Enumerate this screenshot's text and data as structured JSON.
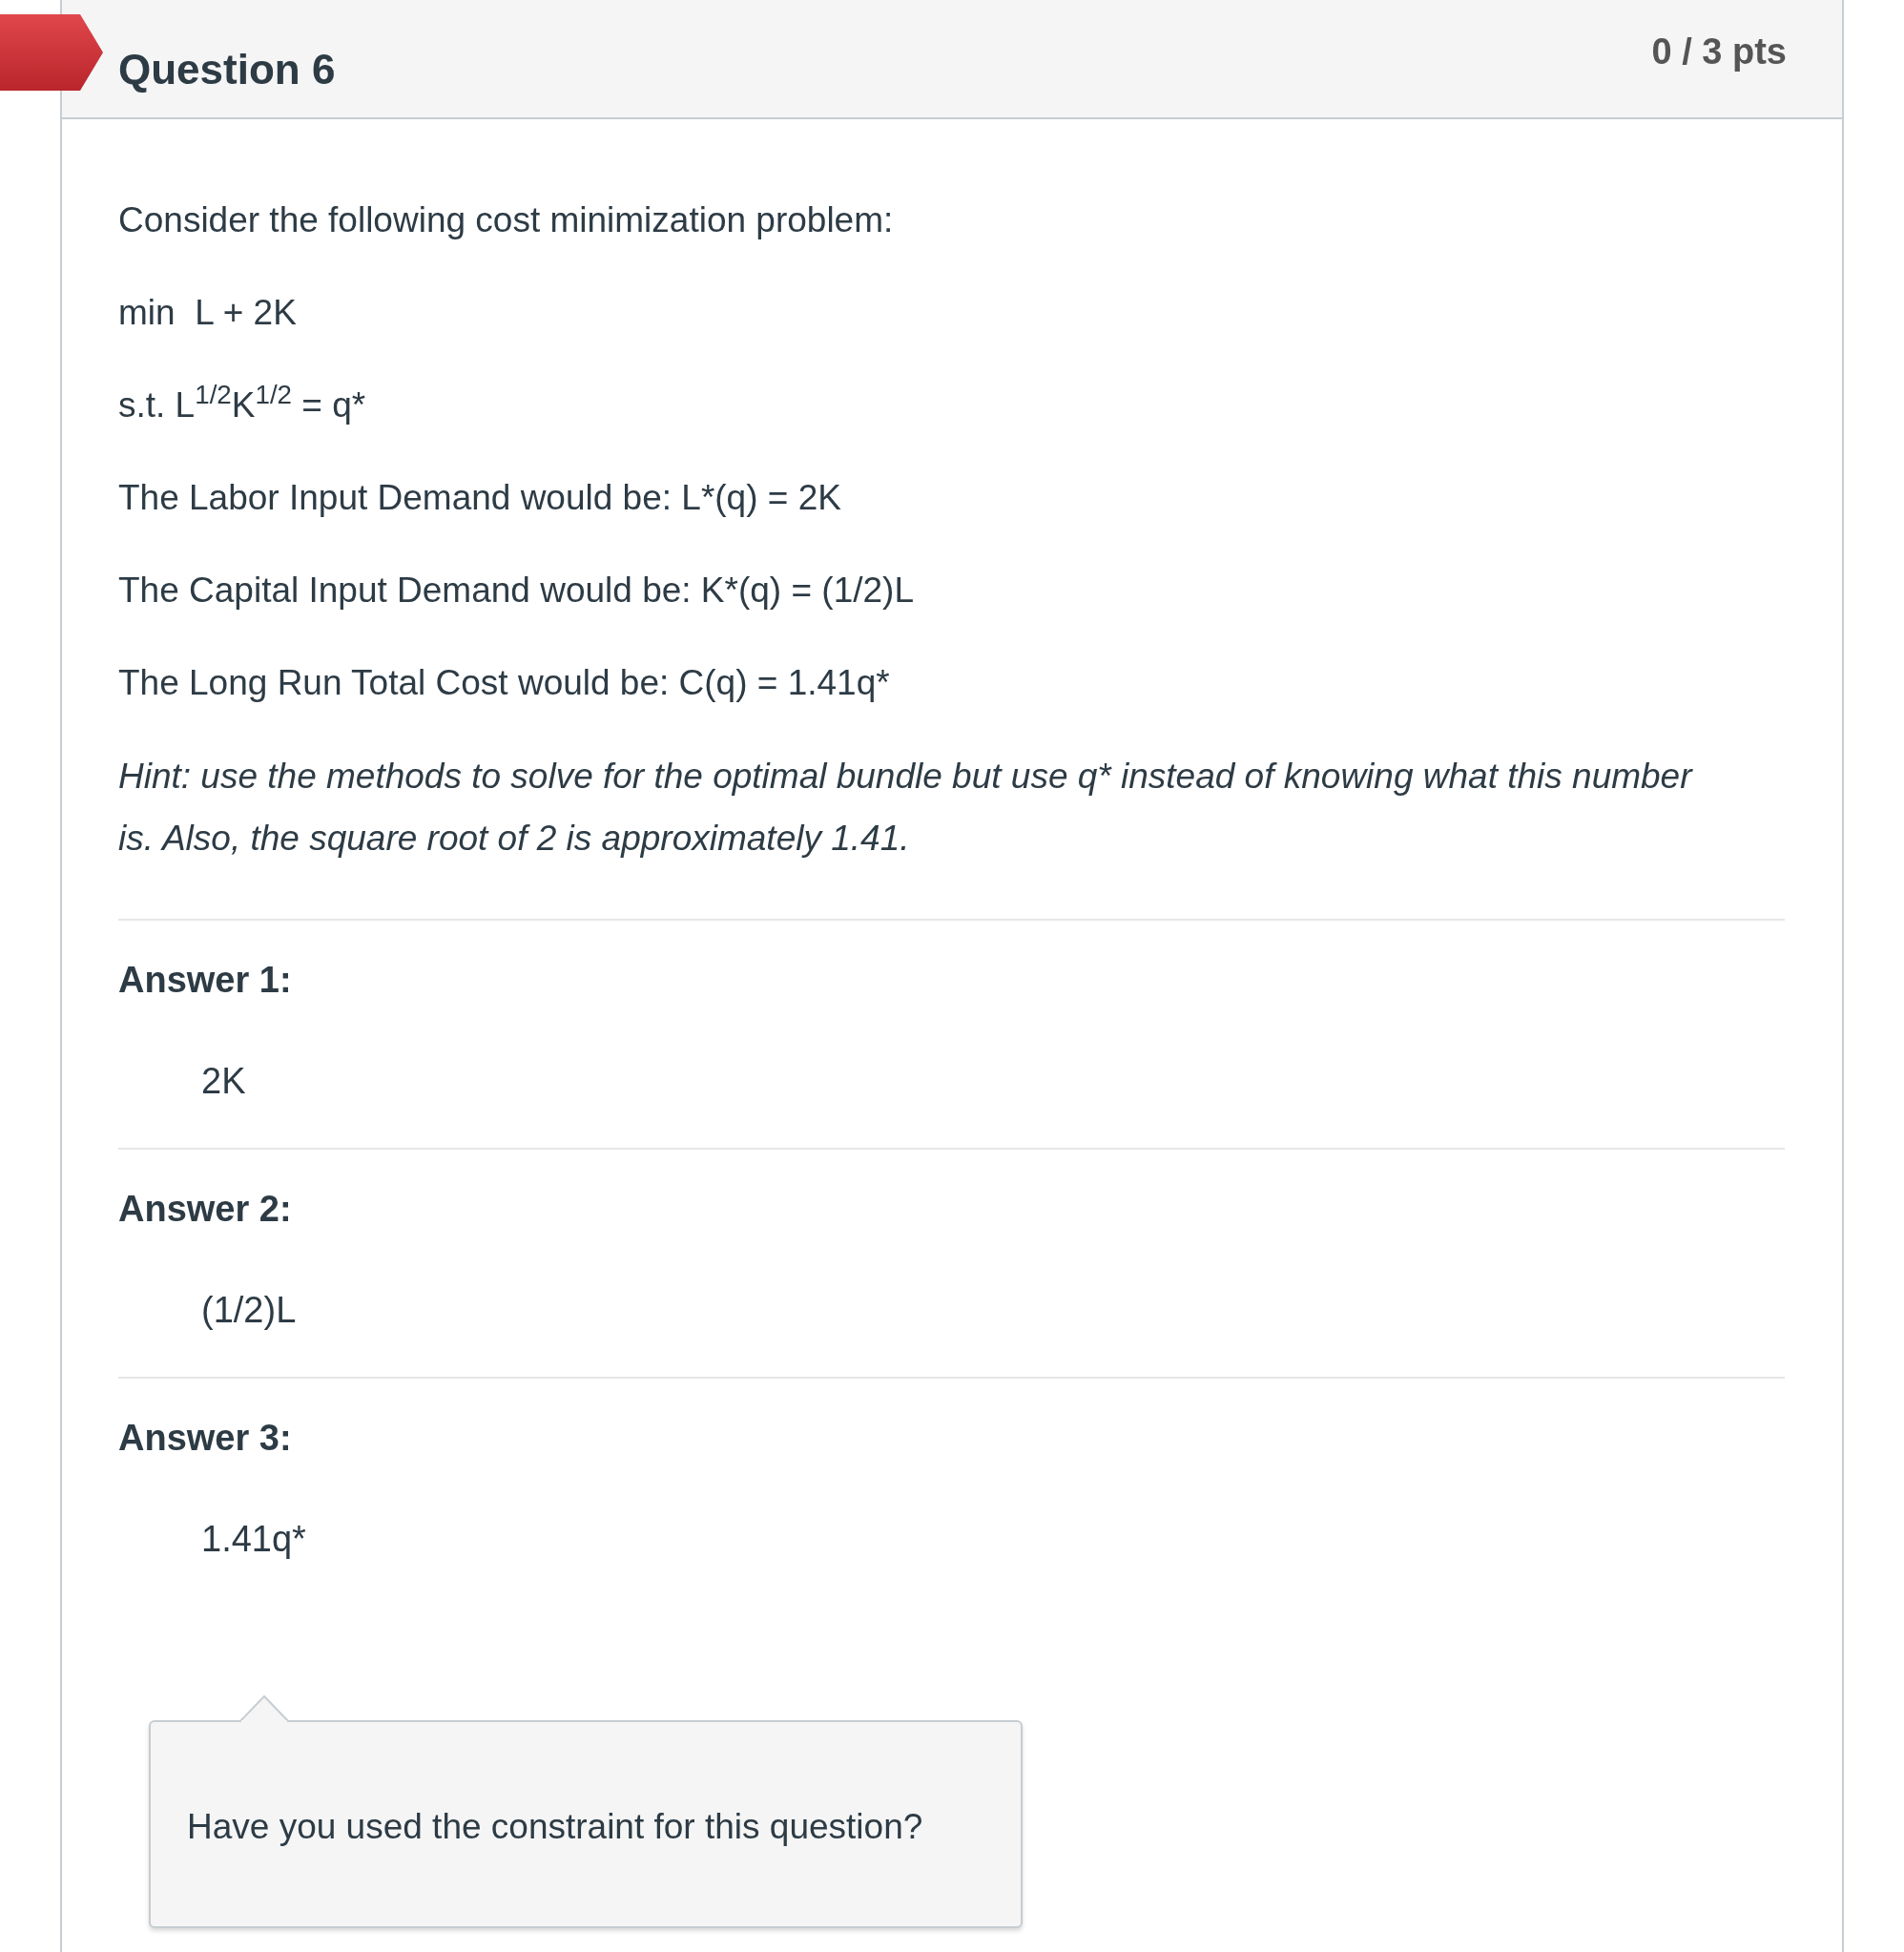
{
  "question": {
    "title": "Question 6",
    "score": "0 / 3 pts",
    "flagged": true
  },
  "body": {
    "paragraphs": [
      "Consider the following cost minimization problem:",
      "min  L + 2K",
      "s.t. L$^{1/2}$K$^{1/2}$ = q*",
      "The Labor Input Demand would be: L*(q) = 2K",
      "The Capital Input Demand would be: K*(q) = (1/2)L",
      "The Long Run Total Cost would be: C(q) = 1.41q*"
    ],
    "hint": "Hint: use the methods to solve for the optimal bundle but use q* instead of knowing what this number is. Also, the square root of 2 is approximately 1.41."
  },
  "answers": [
    {
      "label": "Answer 1:",
      "value": "2K"
    },
    {
      "label": "Answer 2:",
      "value": "(1/2)L"
    },
    {
      "label": "Answer 3:",
      "value": "1.41q*"
    }
  ],
  "tooltip": {
    "text": "Have you used the constraint for this question?"
  }
}
